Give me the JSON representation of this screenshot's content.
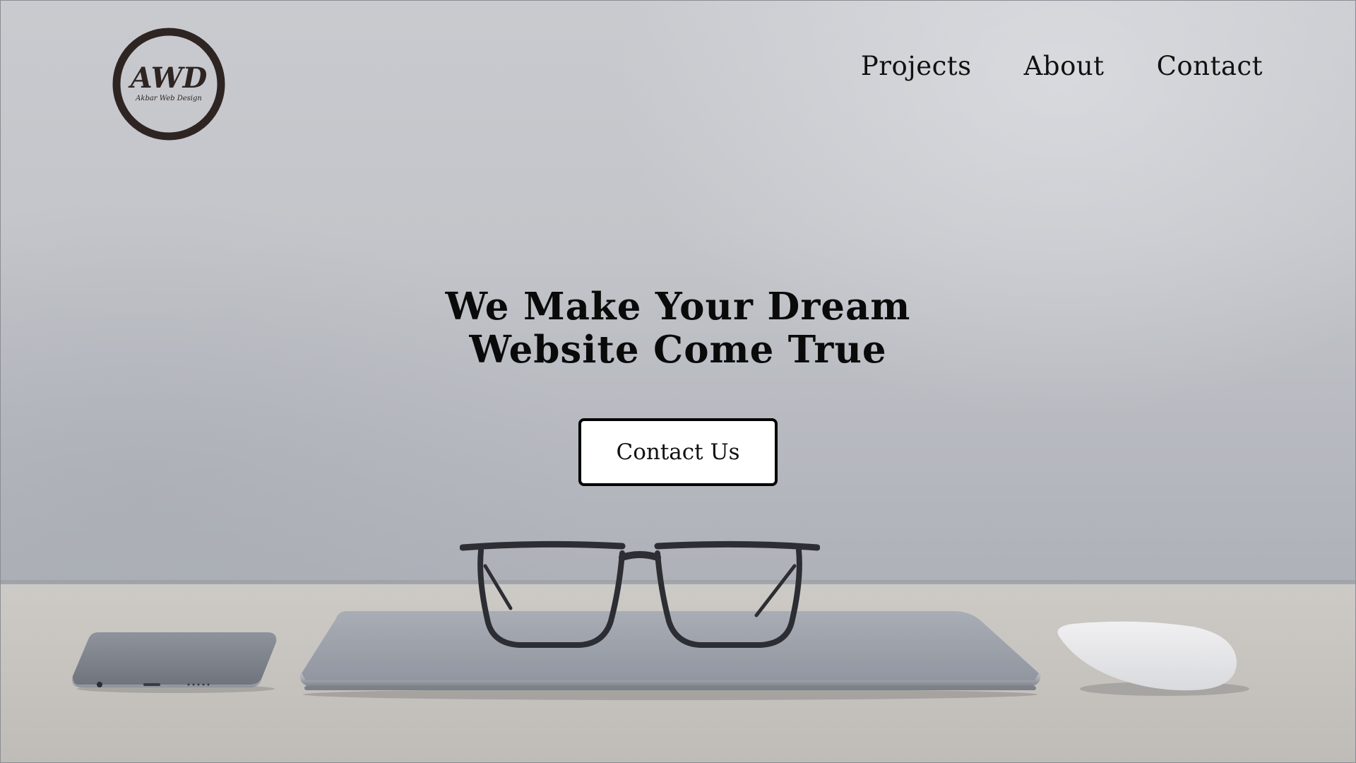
{
  "brand": {
    "logo_letters": "AWD",
    "logo_subtitle": "Akbar Web Design",
    "logo_color": "#2e2523"
  },
  "nav": {
    "items": [
      {
        "label": "Projects"
      },
      {
        "label": "About"
      },
      {
        "label": "Contact"
      }
    ]
  },
  "hero": {
    "headline_line1": "We Make Your Dream",
    "headline_line2": "Website Come True",
    "cta_label": "Contact Us",
    "background_objects": [
      "glasses-icon",
      "laptop-icon",
      "phone-icon",
      "mouse-icon"
    ]
  },
  "colors": {
    "text": "#0a0a0a",
    "button_bg": "#ffffff",
    "button_border": "#000000"
  }
}
